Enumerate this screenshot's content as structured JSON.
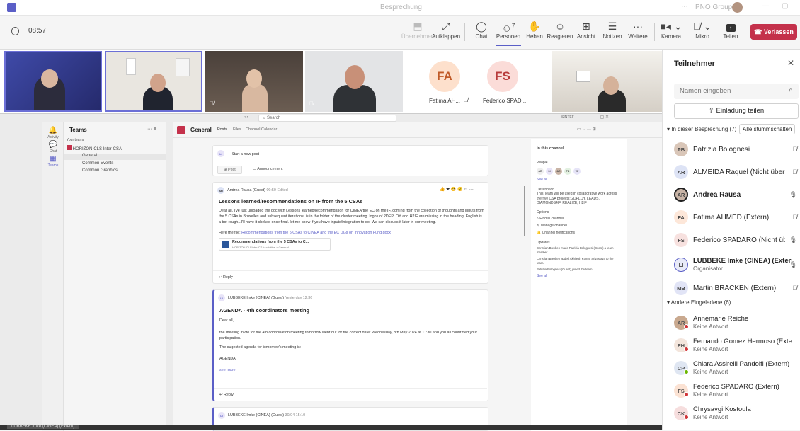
{
  "window": {
    "title": "Besprechung",
    "org": "PNO Group"
  },
  "meeting": {
    "time": "08:57"
  },
  "toolbar": {
    "items": [
      {
        "label": "Übernehmen",
        "icon": "share-screen-icon"
      },
      {
        "label": "Aufklappen",
        "icon": "expand-icon"
      },
      {
        "label": "Chat",
        "icon": "chat-icon"
      },
      {
        "label": "Personen",
        "icon": "people-icon",
        "count": "7"
      },
      {
        "label": "Heben",
        "icon": "raise-hand-icon"
      },
      {
        "label": "Reagieren",
        "icon": "react-icon"
      },
      {
        "label": "Ansicht",
        "icon": "view-icon"
      },
      {
        "label": "Notizen",
        "icon": "notes-icon"
      },
      {
        "label": "Weitere",
        "icon": "more-icon"
      },
      {
        "label": "Kamera",
        "icon": "camera-icon"
      },
      {
        "label": "Mikro",
        "icon": "mic-off-icon"
      },
      {
        "label": "Teilen",
        "icon": "share-icon"
      }
    ],
    "leave_label": "Verlassen"
  },
  "tiles": [
    {
      "initials": "FA",
      "name": "Fatima AH..."
    },
    {
      "initials": "FS",
      "name": "Federico SPAD..."
    }
  ],
  "shared": {
    "search": "Search",
    "org_name": "SINTEF",
    "teams_title": "Teams",
    "your_teams": "Your teams",
    "team_name": "HORIZON-CLS Inter-CSA",
    "channels": [
      "General",
      "Common Events",
      "Common Graphics"
    ],
    "rail": [
      "Activity",
      "Chat",
      "Teams"
    ],
    "channel_title": "General",
    "channel_tabs": [
      "Posts",
      "Files",
      "Channel Calendar"
    ],
    "new_post": "Start a new post",
    "post_btn": "Post",
    "announcement_btn": "Announcement",
    "post1": {
      "author": "Andrea Rausa (Guest)",
      "time": "09:50",
      "edited": "Edited",
      "title": "Lessons learned/recommendations on IF from the 5 CSAs",
      "body": "Dear all, I've just uploaded the doc with Lessons learned/recommendation for CINEA/the EC on the IF, coming from the collection of thoughts and inputs from the 5 CSAs in Bruxelles and subsequent iterations. is in the folder of the cluster meeting. logos of 2DEPLOY and H2IF are missing in the heading. English is a bot rough...I'll have it cheked once final. let me know if you have inputs/integration to do. We can discuss it later in our meeting.",
      "file_intro": "Here the file:",
      "file_link": "Recommendations from the 5 CSAs to CINEA and the EC DGs on Innovation Fund.docx",
      "attachment_name": "Recommendations from the 5 CSAs to C...",
      "attachment_path": "HORIZON-CLSInter-CSAActivities > General",
      "reply": "Reply"
    },
    "post2": {
      "author": "LUBBEKE Imke (CINEA) (Guest)",
      "time": "Yesterday 12:36",
      "title": "AGENDA - 4th coordinators meeting",
      "greeting": "Dear all,",
      "body1": "the meeting invite for the 4th coordination meeting tomorrow went out for the correct date: Wednesday, 8th May 2024 at 11:30 and you all confirmed your participation.",
      "body2": "The sugested agenda for tomorrow's meeting is:",
      "body3": "AGENDA:",
      "see_more": "see more",
      "reply": "Reply"
    },
    "post3": {
      "author": "LUBBEKE Imke (CINEA) (Guest)",
      "time": "30/04 15:10"
    },
    "side": {
      "title": "In this channel",
      "people": "People",
      "see_all": "See all",
      "description_h": "Description",
      "description": "This Team will be used in collaborative work across the five CSA projects: 2DPLOY, LEADS, DIAMONDS4IF, REALIZE, H2IF",
      "options": "Options",
      "opt1": "Find in channel",
      "opt2": "Manage channel",
      "opt3": "Channel notifications",
      "updates": "Updates",
      "u1": "Christian Brekken made Patrizia Bolognesi (Guest) a team member.",
      "u2": "Christian Brekken added Akhilesh Kumar Srivastava to the team.",
      "u3": "Patrizia Bolognesi (Guest) joined the team.",
      "see_all2": "See all"
    },
    "avatars": [
      "AR",
      "LI",
      "AR",
      "FB",
      "VF"
    ]
  },
  "panel": {
    "title": "Teilnehmer",
    "search_placeholder": "Namen eingeben",
    "invite": "Einladung teilen",
    "in_meeting": "In dieser Besprechung (7)",
    "mute_all": "Alle stummschalten",
    "others": "Andere Eingeladene (6)",
    "participants": [
      {
        "initials": "PB",
        "name": "Patrizia Bolognesi",
        "mic": "muted",
        "color": "#d9c6b8"
      },
      {
        "initials": "AR",
        "name": "ALMEIDA Raquel (Nicht überp...",
        "mic": "muted",
        "color": "#dde3f5"
      },
      {
        "initials": "AR",
        "name": "Andrea Rausa",
        "mic": "on",
        "color": "#c9b4a6",
        "bold": true
      },
      {
        "initials": "FA",
        "name": "Fatima AHMED (Extern)",
        "mic": "muted",
        "color": "#fde7d9"
      },
      {
        "initials": "FS",
        "name": "Federico SPADARO (Nicht übe...",
        "mic": "on",
        "color": "#f7e1df"
      },
      {
        "initials": "LI",
        "name": "LUBBEKE Imke (CINEA) (Extern)",
        "sub": "Organisator",
        "mic": "on",
        "color": "#e8eaf8"
      },
      {
        "initials": "MB",
        "name": "Martin BRACKEN (Extern)",
        "mic": "muted",
        "color": "#e1e4f6"
      }
    ],
    "invited": [
      {
        "initials": "AR",
        "name": "Annemarie Reiche",
        "sub": "Keine Antwort",
        "color": "#c9a98f"
      },
      {
        "initials": "FH",
        "name": "Fernando Gomez Hermoso (Extern)",
        "sub": "Keine Antwort",
        "color": "#f3e5dc"
      },
      {
        "initials": "CP",
        "name": "Chiara Assirelli Pandolfi (Extern)",
        "sub": "Keine Antwort",
        "color": "#dfe6f2"
      },
      {
        "initials": "FS",
        "name": "Federico SPADARO (Extern)",
        "sub": "Keine Antwort",
        "color": "#fbe2d3"
      },
      {
        "initials": "CK",
        "name": "Chrysavgi Kostoula",
        "sub": "Keine Antwort",
        "color": "#f6dede"
      }
    ]
  },
  "taskbar": {
    "label": "LUBBEKE Imke (CINEA) (Extern)"
  }
}
